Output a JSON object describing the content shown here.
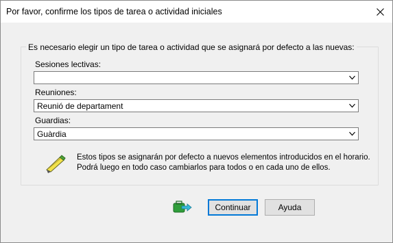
{
  "dialog": {
    "title": "Por favor, confirme los tipos de tarea o actividad iniciales"
  },
  "group": {
    "caption": "Es necesario elegir un tipo de tarea o actividad que se asignará por defecto a las  nuevas:"
  },
  "fields": {
    "sesiones": {
      "label": "Sesiones lectivas:",
      "value": ""
    },
    "reuniones": {
      "label": "Reuniones:",
      "value": "Reunió de departament"
    },
    "guardias": {
      "label": "Guardias:",
      "value": "Guàrdia"
    }
  },
  "info": {
    "line1": "Estos tipos se asignarán por defecto a nuevos elementos introducidos en el horario.",
    "line2": "Podrá luego en todo caso cambiarlos para todos o en cada uno de ellos."
  },
  "buttons": {
    "continue": "Continuar",
    "help": "Ayuda"
  },
  "icons": {
    "info": "pencil-note-icon",
    "exit": "exit-icon",
    "close": "close-icon",
    "dropdown": "chevron-down-icon"
  }
}
